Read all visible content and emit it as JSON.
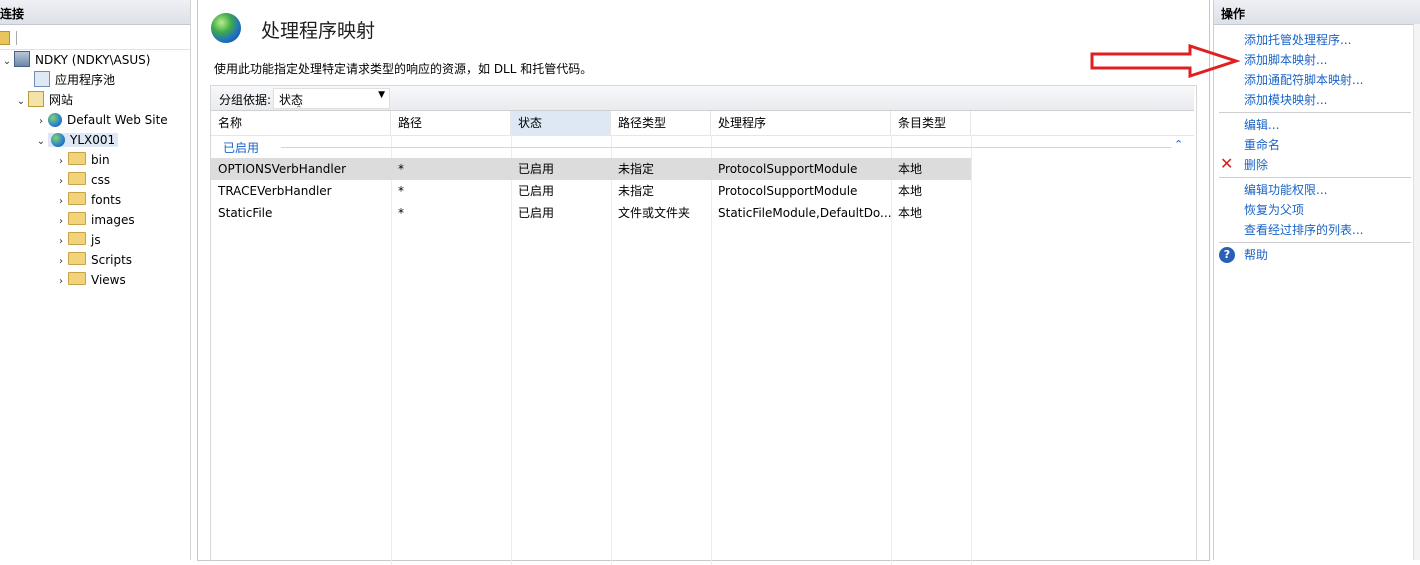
{
  "connections": {
    "title": "连接",
    "tree": [
      {
        "label": "NDKY (NDKY\\ASUS)",
        "icon": "server-icon"
      },
      {
        "label": "应用程序池",
        "icon": "app-pool-icon"
      },
      {
        "label": "网站",
        "icon": "sites-icon"
      },
      {
        "label": "Default Web Site",
        "icon": "globe-icon"
      },
      {
        "label": "YLX001",
        "icon": "globe-icon"
      },
      {
        "label": "bin",
        "icon": "folder-icon"
      },
      {
        "label": "css",
        "icon": "folder-icon"
      },
      {
        "label": "fonts",
        "icon": "folder-icon"
      },
      {
        "label": "images",
        "icon": "folder-icon"
      },
      {
        "label": "js",
        "icon": "folder-icon"
      },
      {
        "label": "Scripts",
        "icon": "folder-icon"
      },
      {
        "label": "Views",
        "icon": "folder-icon"
      }
    ]
  },
  "main": {
    "title": "处理程序映射",
    "description": "使用此功能指定处理特定请求类型的响应的资源，如 DLL 和托管代码。",
    "group_by_label": "分组依据:",
    "group_by_value": "状态",
    "columns": [
      "名称",
      "路径",
      "状态",
      "路径类型",
      "处理程序",
      "条目类型"
    ],
    "group_name": "已启用",
    "rows": [
      [
        "OPTIONSVerbHandler",
        "*",
        "已启用",
        "未指定",
        "ProtocolSupportModule",
        "本地"
      ],
      [
        "TRACEVerbHandler",
        "*",
        "已启用",
        "未指定",
        "ProtocolSupportModule",
        "本地"
      ],
      [
        "StaticFile",
        "*",
        "已启用",
        "文件或文件夹",
        "StaticFileModule,DefaultDo...",
        "本地"
      ]
    ]
  },
  "actions": {
    "title": "操作",
    "items": [
      "添加托管处理程序...",
      "添加脚本映射...",
      "添加通配符脚本映射...",
      "添加模块映射...",
      "编辑...",
      "重命名",
      "删除",
      "编辑功能权限...",
      "恢复为父项",
      "查看经过排序的列表...",
      "帮助"
    ]
  },
  "colors": {
    "link": "#1a63c6",
    "annotation_arrow": "#e02020",
    "selected_row": "#dcdcdc",
    "sort_column": "#dde8f4"
  }
}
